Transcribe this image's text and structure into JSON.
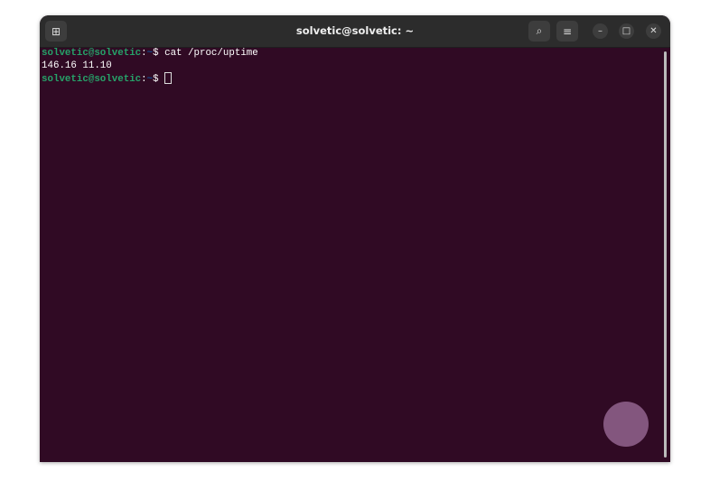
{
  "window": {
    "title": "solvetic@solvetic: ~"
  },
  "terminal": {
    "lines": [
      {
        "user": "solvetic@solvetic",
        "sep": ":",
        "path": "~",
        "prompt": "$ ",
        "cmd": "cat /proc/uptime"
      },
      {
        "output": "146.16 11.10"
      },
      {
        "user": "solvetic@solvetic",
        "sep": ":",
        "path": "~",
        "prompt": "$ ",
        "cmd": ""
      }
    ]
  },
  "colors": {
    "background": "#300a24",
    "user": "#26a269",
    "path": "#12488b"
  }
}
